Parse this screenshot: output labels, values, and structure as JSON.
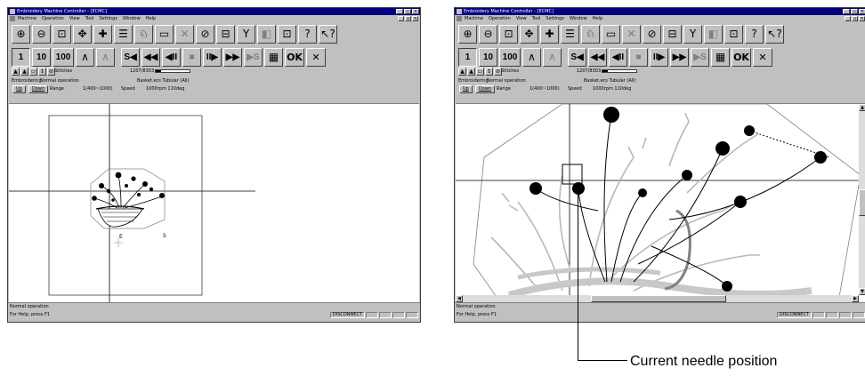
{
  "window": {
    "title": "Embroidery Machine Controller - [ECMC]",
    "menus": [
      "Machine",
      "Operation",
      "View",
      "Tool",
      "Settings",
      "Window",
      "Help"
    ]
  },
  "toolbar1": {
    "icons": [
      "zoom-in-icon",
      "zoom-out-icon",
      "zoom-area-icon",
      "move-icon",
      "fit-icon",
      "stitch-lines-icon",
      "machine-icon",
      "monitor-icon",
      "cancel-x-icon",
      "prohibit-icon",
      "frame-icon",
      "trim-icon",
      "color-icon",
      "monitor-edit-icon",
      "help-icon",
      "context-help-icon"
    ],
    "glyphs": [
      "⊕",
      "⊖",
      "⊡",
      "✥",
      "✚",
      "☰",
      "♘",
      "▭",
      "✕",
      "⊘",
      "⊟",
      "Y",
      "◧",
      "⊡",
      "?",
      "↖?"
    ]
  },
  "toolbar2": {
    "step_labels": [
      "1",
      "10",
      "100"
    ],
    "buttons": [
      "∧",
      "∧",
      "S◀",
      "◀◀",
      "◀II",
      "■",
      "II▶",
      "▶▶",
      "▶S"
    ],
    "ok_label": "OK",
    "cancel_glyph": "✕"
  },
  "info": {
    "stitches_label": "Stitches",
    "stitches_value": "1207/8303",
    "stitch_progress": 0.145,
    "mode_label": "Embroidering",
    "status": "Normal operation",
    "file": "Basket.ecs Tubular (All)",
    "up_label": "Up",
    "down_label": "Down",
    "range_label": "Range",
    "range_value": "1(400~1000)",
    "speed_label": "Speed",
    "speed_value": "1000rpm 110deg"
  },
  "design": {
    "start_marker": "E",
    "end_marker": "S"
  },
  "statusbar": {
    "status_text": "Normal operation",
    "help_text": "For Help, press F1",
    "connection": "DISCONNECT"
  },
  "callout": {
    "label": "Current needle position"
  },
  "colors": {
    "titlebar": "#000080",
    "chrome": "#c0c0c0",
    "canvas": "#ffffff"
  }
}
